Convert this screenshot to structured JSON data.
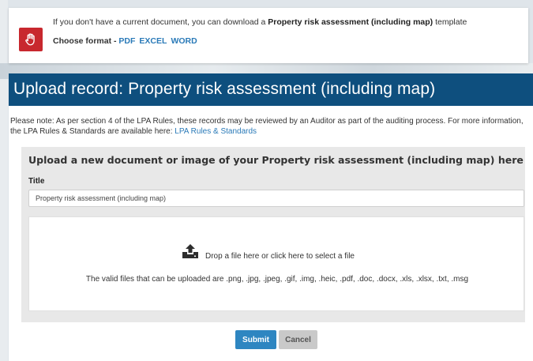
{
  "notice": {
    "icon": "hand-stop-icon",
    "icon_color": "#c8282e",
    "line1_prefix": "If you don't have a current document, you can download a ",
    "line1_bold": "Property risk assessment (including map)",
    "line1_suffix": " template",
    "choose_label": "Choose format - ",
    "formats": [
      "PDF",
      "EXCEL",
      "WORD"
    ]
  },
  "panel": {
    "title": "Upload record: Property risk assessment (including map)",
    "header_color": "#0e4f7e",
    "note_text": "Please note: As per section 4 of the LPA Rules, these records may be reviewed by an Auditor as part of the auditing process. For more information, the LPA Rules & Standards are available here: ",
    "note_link": "LPA Rules & Standards"
  },
  "upload": {
    "heading": "Upload a new document or image of your Property risk assessment (including map) here",
    "title_label": "Title",
    "title_value": "Property risk assessment (including map)",
    "drop_icon": "upload-icon",
    "drop_text": "Drop a file here or click here to select a file",
    "valid_files": "The valid files that can be uploaded are .png, .jpg, .jpeg, .gif, .img, .heic, .pdf, .doc, .docx, .xls, .xlsx, .txt, .msg"
  },
  "actions": {
    "submit_label": "Submit",
    "cancel_label": "Cancel",
    "submit_color": "#2e86c1"
  }
}
